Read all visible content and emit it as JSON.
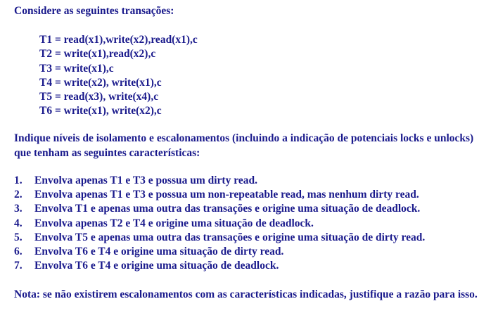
{
  "intro": "Considere as seguintes transações:",
  "transactions": [
    "T1 = read(x1),write(x2),read(x1),c",
    "T2 = write(x1),read(x2),c",
    "T3 = write(x1),c",
    "T4 = write(x2), write(x1),c",
    "T5 = read(x3), write(x4),c",
    "T6 = write(x1), write(x2),c"
  ],
  "instruction": "Indique níveis de isolamento e escalonamentos (incluindo a indicação de potenciais locks e unlocks) que tenham as seguintes características:",
  "tasks": [
    {
      "num": "1.",
      "text": "Envolva apenas T1 e T3 e possua um dirty read."
    },
    {
      "num": "2.",
      "text": "Envolva apenas T1 e T3 e possua um non-repeatable read, mas nenhum dirty read."
    },
    {
      "num": "3.",
      "text": "Envolva T1 e apenas uma outra das transações e origine uma situação de deadlock."
    },
    {
      "num": "4.",
      "text": "Envolva apenas T2 e T4 e origine uma situação de deadlock."
    },
    {
      "num": "5.",
      "text": "Envolva T5 e apenas uma outra das transações e origine uma situação de dirty read."
    },
    {
      "num": "6.",
      "text": "Envolva T6 e T4 e origine uma situação de dirty read."
    },
    {
      "num": "7.",
      "text": "Envolva T6 e T4 e origine uma situação de deadlock."
    }
  ],
  "note": "Nota: se não existirem escalonamentos com as características indicadas, justifique a razão para isso."
}
